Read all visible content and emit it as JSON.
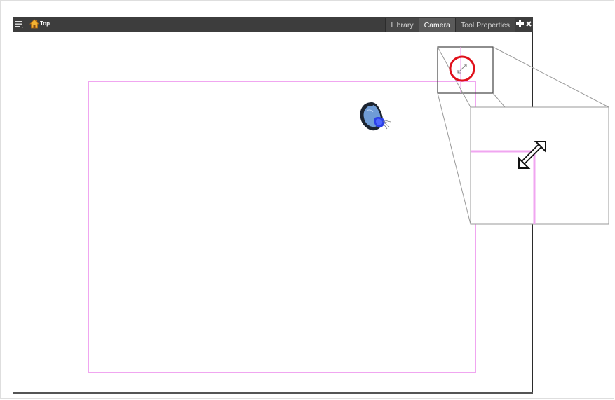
{
  "toolbar": {
    "menu_icon": "hamburger-menu-icon",
    "home_icon": "home-icon",
    "view_name": "Top"
  },
  "tabs": [
    {
      "label": "Library",
      "active": false
    },
    {
      "label": "Camera",
      "active": true
    },
    {
      "label": "Tool Properties",
      "active": false
    }
  ],
  "tab_actions": {
    "add_icon": "plus-icon",
    "close_icon": "close-icon"
  },
  "scene": {
    "camera_frame_color": "#f0a6f0",
    "object": "butterfly-drawing",
    "highlight_color": "#e0101a",
    "handle_icon": "resize-diagonal-arrow-icon"
  }
}
